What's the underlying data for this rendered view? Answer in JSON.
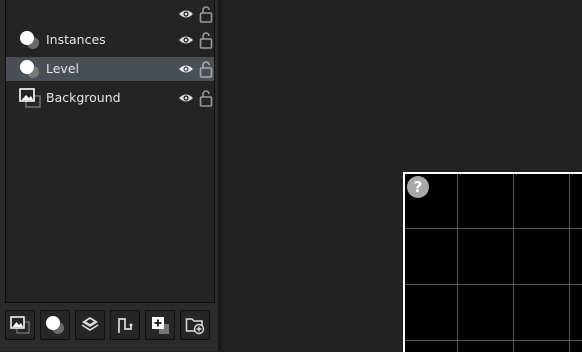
{
  "layers": [
    {
      "label": "",
      "icon": "empty",
      "visible": true,
      "locked": false,
      "selected": false
    },
    {
      "label": "Instances",
      "icon": "instance-layer-icon",
      "visible": true,
      "locked": false,
      "selected": false
    },
    {
      "label": "Level",
      "icon": "instance-layer-icon",
      "visible": true,
      "locked": false,
      "selected": true
    },
    {
      "label": "Background",
      "icon": "background-layer-icon",
      "visible": true,
      "locked": false,
      "selected": false
    }
  ],
  "toolbar": {
    "buttons": [
      "add-background-layer-icon",
      "add-instance-layer-icon",
      "add-tile-layer-icon",
      "add-path-layer-icon",
      "add-asset-layer-icon",
      "add-folder-icon"
    ]
  },
  "canvas": {
    "unknown_badge": "?"
  },
  "colors": {
    "panel_bg": "#242424",
    "selected_row": "#4a4f56",
    "workspace_bg": "#222222",
    "room_bg": "#000000",
    "grid": "#555555"
  }
}
